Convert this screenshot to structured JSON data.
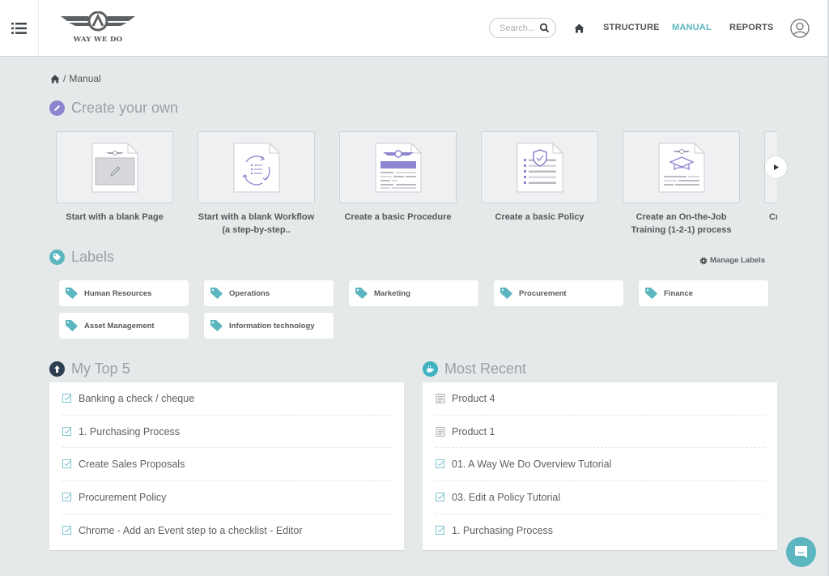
{
  "header": {
    "logo_text": "WAY WE DO",
    "search_placeholder": "Search...",
    "nav": [
      {
        "label": "STRUCTURE",
        "active": false
      },
      {
        "label": "MANUAL",
        "active": true
      },
      {
        "label": "REPORTS",
        "active": false
      }
    ]
  },
  "breadcrumb": {
    "separator": "/",
    "current": "Manual"
  },
  "create": {
    "title": "Create your own",
    "templates": [
      {
        "label": "Start with a blank Page",
        "icon": "blank-page-icon"
      },
      {
        "label": "Start with a blank Workflow (a step-by-step..",
        "icon": "workflow-icon"
      },
      {
        "label": "Create a basic Procedure",
        "icon": "procedure-icon"
      },
      {
        "label": "Create a basic Policy",
        "icon": "policy-icon"
      },
      {
        "label": "Create an On-the-Job Training (1-2-1) process",
        "icon": "training-icon"
      },
      {
        "label": "Cr",
        "icon": "template-icon"
      }
    ]
  },
  "labels": {
    "title": "Labels",
    "manage_label": "Manage Labels",
    "items": [
      "Human Resources",
      "Operations",
      "Marketing",
      "Procurement",
      "Finance",
      "Asset Management",
      "Information technology"
    ]
  },
  "top5": {
    "title": "My Top 5",
    "items": [
      {
        "label": "Banking a check / cheque",
        "icon": "checklist-icon"
      },
      {
        "label": "1. Purchasing Process",
        "icon": "checklist-icon"
      },
      {
        "label": "Create Sales Proposals",
        "icon": "checklist-icon"
      },
      {
        "label": "Procurement Policy",
        "icon": "checklist-icon"
      },
      {
        "label": "Chrome - Add an Event step to a checklist - Editor",
        "icon": "checklist-icon"
      }
    ]
  },
  "recent": {
    "title": "Most Recent",
    "items": [
      {
        "label": "Product 4",
        "icon": "document-icon"
      },
      {
        "label": "Product 1",
        "icon": "document-icon"
      },
      {
        "label": "01. A Way We Do Overview Tutorial",
        "icon": "checklist-icon"
      },
      {
        "label": "03. Edit a Policy Tutorial",
        "icon": "checklist-icon"
      },
      {
        "label": "1. Purchasing Process",
        "icon": "checklist-icon"
      }
    ]
  },
  "colors": {
    "accent": "#5bb6c0",
    "purple": "#8b86cf",
    "navy": "#2c3e50",
    "background": "#e6e9ea"
  }
}
